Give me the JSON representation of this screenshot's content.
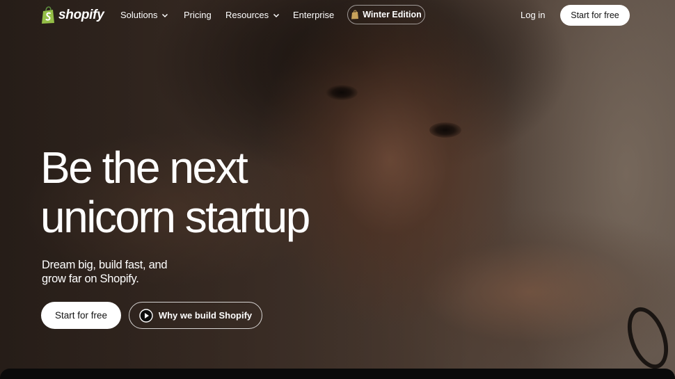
{
  "brand": {
    "name": "shopify",
    "logo_color": "#95bf47"
  },
  "nav": {
    "items": [
      {
        "label": "Solutions",
        "has_dropdown": true
      },
      {
        "label": "Pricing",
        "has_dropdown": false
      },
      {
        "label": "Resources",
        "has_dropdown": true
      },
      {
        "label": "Enterprise",
        "has_dropdown": false
      }
    ],
    "edition_label": "Winter Edition",
    "login_label": "Log in",
    "start_label": "Start for free"
  },
  "hero": {
    "headline_line1": "Be the next",
    "headline_line2": "unicorn startup",
    "subhead_line1": "Dream big, build fast, and",
    "subhead_line2": "grow far on Shopify.",
    "primary_cta": "Start for free",
    "secondary_cta": "Why we build Shopify",
    "secondary_icon": "play-icon"
  },
  "colors": {
    "text": "#ffffff",
    "button_bg": "#ffffff",
    "button_text": "#111111"
  }
}
